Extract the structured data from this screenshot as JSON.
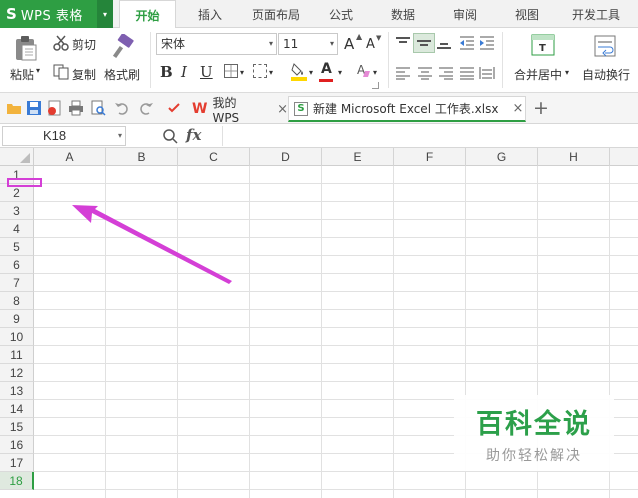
{
  "app": {
    "logo": "S",
    "title": "WPS 表格",
    "menu_caret": "▾"
  },
  "menu_tabs": [
    "开始",
    "插入",
    "页面布局",
    "公式",
    "数据",
    "审阅",
    "视图",
    "开发工具"
  ],
  "active_tab_index": 0,
  "ribbon": {
    "paste": "粘贴",
    "dropdown_arrow": "▾",
    "cut": "剪切",
    "copy": "复制",
    "format_painter": "格式刷",
    "font_name": "宋体",
    "font_size": "11",
    "grow_font": "A",
    "shrink_font": "A",
    "bold": "B",
    "italic": "I",
    "underline": "U",
    "fill_color": "#ffd700",
    "font_color_letter": "A",
    "font_color": "#e02020",
    "merge_center": "合并居中",
    "wrap_text": "自动换行"
  },
  "doc_tabs": [
    {
      "label": "我的WPS",
      "icon": "W",
      "icon_color": "#e43d30"
    },
    {
      "label": "新建 Microsoft Excel 工作表.xlsx",
      "icon": "S",
      "icon_color": "#2e9e43"
    }
  ],
  "close_glyph": "×",
  "new_tab_glyph": "+",
  "formula_bar": {
    "cell_ref": "K18",
    "fx_label": "fx",
    "value": ""
  },
  "sheet": {
    "columns": [
      "A",
      "B",
      "C",
      "D",
      "E",
      "F",
      "G",
      "H"
    ],
    "rows": [
      "1",
      "2",
      "3",
      "4",
      "5",
      "6",
      "7",
      "8",
      "9",
      "10",
      "11",
      "12",
      "13",
      "14",
      "15",
      "16",
      "17",
      "18"
    ],
    "active_row": "18"
  },
  "annotation": {
    "color": "#d43fd6"
  },
  "watermark": {
    "title": "百科全说",
    "subtitle": "助你轻松解决"
  },
  "colors": {
    "accent": "#2e9e43"
  }
}
